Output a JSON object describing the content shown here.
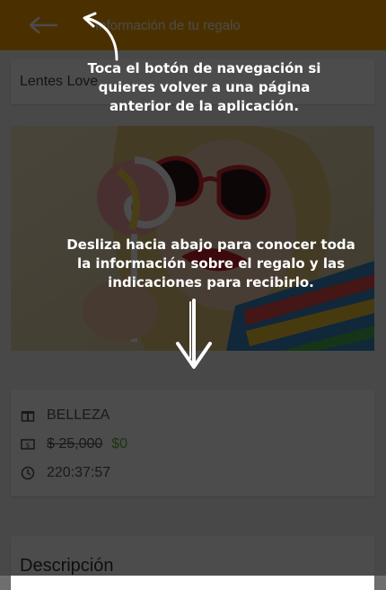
{
  "appbar": {
    "title": "Información de tu regalo",
    "back_icon": "arrow-left-icon",
    "color": "#f7a200"
  },
  "gift": {
    "name": "Lentes Love",
    "category_icon": "gift-box-icon",
    "category": "BELLEZA",
    "price_icon": "money-icon",
    "price_old": "$ 25,000",
    "price_new": "$0",
    "time_icon": "clock-icon",
    "time": "220:37:57"
  },
  "description": {
    "heading": "Descripción"
  },
  "coach": {
    "hint_navigation": "Toca el botón de navegación si quieres volver a una página anterior de la aplicación.",
    "hint_scroll": "Desliza hacia abajo para conocer toda la información sobre el regalo y las indicaciones para recibirlo."
  }
}
